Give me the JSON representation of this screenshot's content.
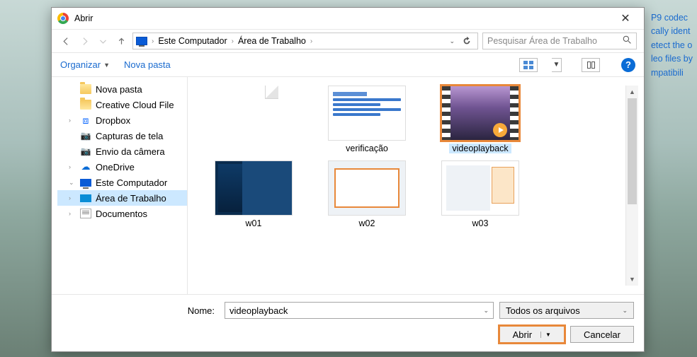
{
  "background_links": [
    "P9 codec",
    "cally ident",
    "etect the o",
    "leo files by",
    "mpatibili"
  ],
  "title": "Abrir",
  "breadcrumb": {
    "root": "Este Computador",
    "current": "Área de Trabalho"
  },
  "search_placeholder": "Pesquisar Área de Trabalho",
  "toolbar": {
    "organize": "Organizar",
    "newfolder": "Nova pasta"
  },
  "sidebar": {
    "items": [
      {
        "label": "Nova pasta",
        "icon": "folder"
      },
      {
        "label": "Creative Cloud File",
        "icon": "cc"
      },
      {
        "label": "Dropbox",
        "icon": "dropbox",
        "expandable": true
      },
      {
        "label": "Capturas de tela",
        "icon": "camera"
      },
      {
        "label": "Envio da câmera",
        "icon": "camera"
      },
      {
        "label": "OneDrive",
        "icon": "onedrive",
        "expandable": true
      },
      {
        "label": "Este Computador",
        "icon": "monitor",
        "expandable": true,
        "expanded": true
      },
      {
        "label": "Área de Trabalho",
        "icon": "desktop",
        "expandable": true,
        "selected": true
      },
      {
        "label": "Documentos",
        "icon": "docs",
        "expandable": true
      }
    ]
  },
  "files": [
    {
      "name": "",
      "kind": "blank"
    },
    {
      "name": "verificação",
      "kind": "doc"
    },
    {
      "name": "videoplayback",
      "kind": "video",
      "selected": true
    },
    {
      "name": "w01",
      "kind": "sshot1"
    },
    {
      "name": "w02",
      "kind": "sshot2"
    },
    {
      "name": "w03",
      "kind": "sshot3"
    }
  ],
  "footer": {
    "name_label": "Nome:",
    "name_value": "videoplayback",
    "filter": "Todos os arquivos",
    "open": "Abrir",
    "cancel": "Cancelar"
  }
}
